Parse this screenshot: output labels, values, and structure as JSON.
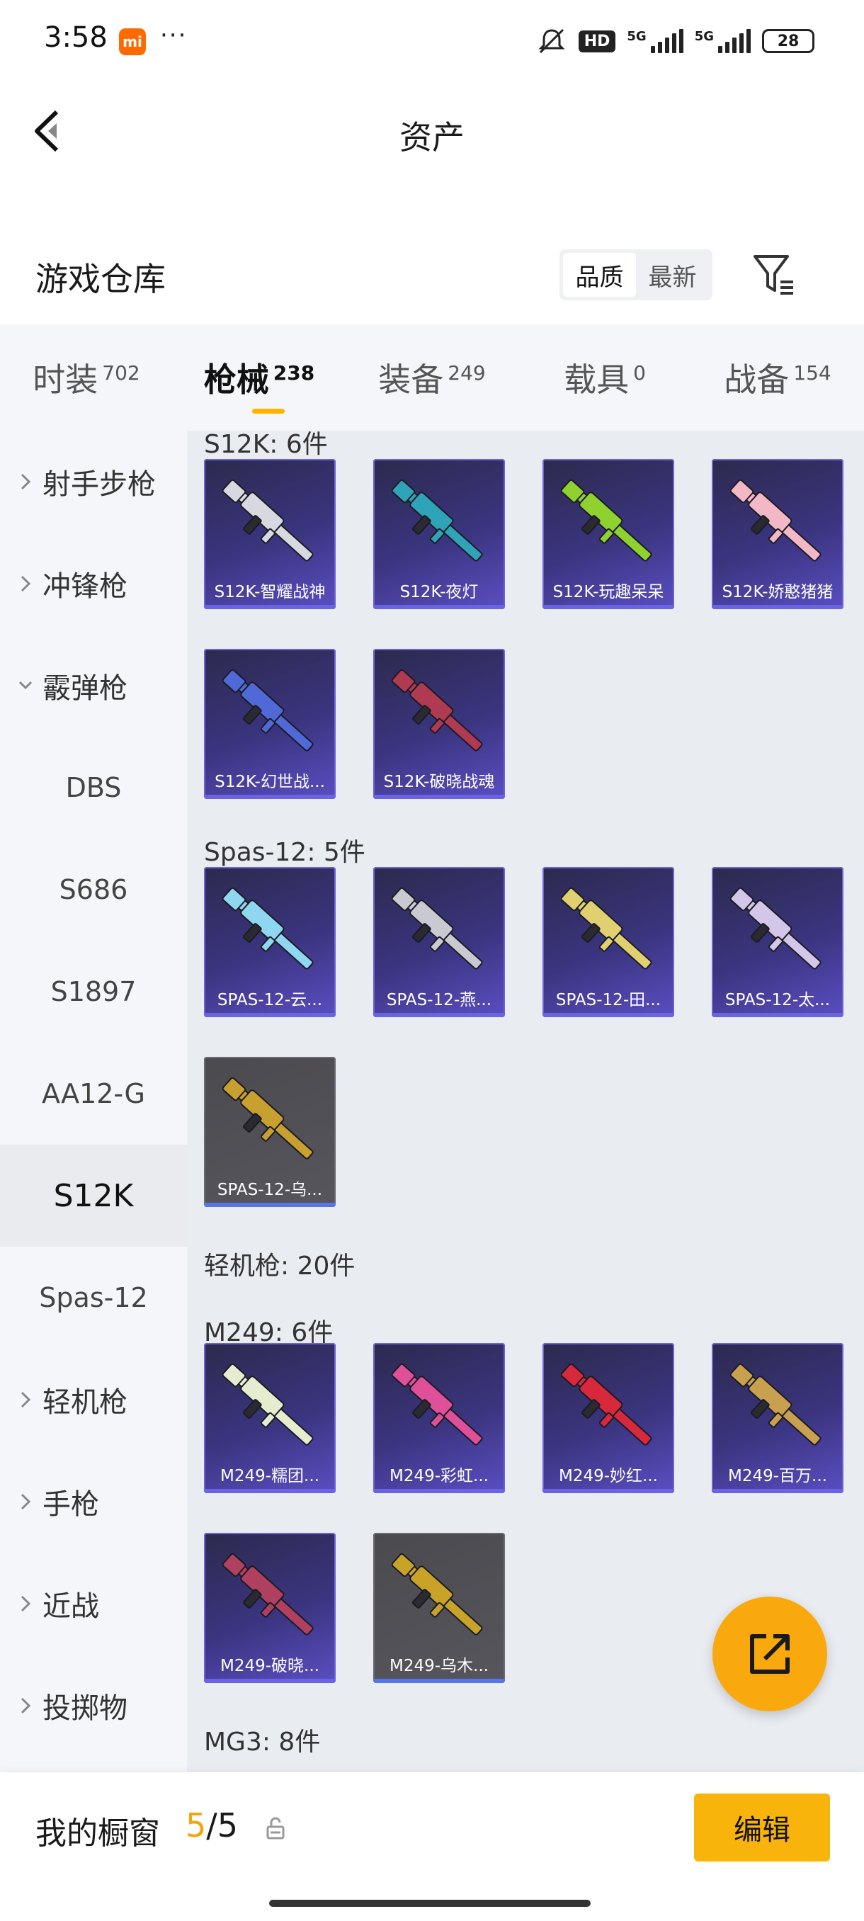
{
  "status_bar": {
    "time": "3:58",
    "mi": "mi",
    "dots": "···",
    "hd": "HD",
    "net1": "5G",
    "net2": "5G",
    "battery": "28"
  },
  "header": {
    "title": "资产"
  },
  "section": {
    "title": "游戏仓库",
    "sort_options": [
      "品质",
      "最新"
    ],
    "sort_active": "品质"
  },
  "tabs": [
    {
      "label": "时装",
      "count": "702"
    },
    {
      "label": "枪械",
      "count": "238",
      "active": true
    },
    {
      "label": "装备",
      "count": "249"
    },
    {
      "label": "载具",
      "count": "0"
    },
    {
      "label": "战备",
      "count": "154"
    }
  ],
  "sidebar": {
    "items": [
      {
        "label": "射手步枪",
        "type": "group",
        "expanded": false
      },
      {
        "label": "冲锋枪",
        "type": "group",
        "expanded": false
      },
      {
        "label": "霰弹枪",
        "type": "group",
        "expanded": true
      },
      {
        "label": "DBS",
        "type": "sub"
      },
      {
        "label": "S686",
        "type": "sub"
      },
      {
        "label": "S1897",
        "type": "sub"
      },
      {
        "label": "AA12-G",
        "type": "sub"
      },
      {
        "label": "S12K",
        "type": "sub",
        "active": true
      },
      {
        "label": "Spas-12",
        "type": "sub"
      },
      {
        "label": "轻机枪",
        "type": "group",
        "expanded": false
      },
      {
        "label": "手枪",
        "type": "group",
        "expanded": false
      },
      {
        "label": "近战",
        "type": "group",
        "expanded": false
      },
      {
        "label": "投掷物",
        "type": "group",
        "expanded": false
      }
    ]
  },
  "content": {
    "groups": [
      {
        "title": "S12K: 6件",
        "cards": [
          {
            "label": "S12K-智耀战神",
            "color": "#d8d8e0",
            "quality": "purple"
          },
          {
            "label": "S12K-夜灯",
            "color": "#2fa3b8",
            "quality": "purple"
          },
          {
            "label": "S12K-玩趣呆呆",
            "color": "#8fd12e",
            "quality": "purple"
          },
          {
            "label": "S12K-娇憨猪猪",
            "color": "#f2b8c6",
            "quality": "purple"
          },
          {
            "label": "S12K-幻世战...",
            "color": "#4f6ad8",
            "quality": "purple"
          },
          {
            "label": "S12K-破晓战魂",
            "color": "#b03a52",
            "quality": "purple"
          }
        ]
      },
      {
        "title": "Spas-12: 5件",
        "cards": [
          {
            "label": "SPAS-12-云...",
            "color": "#8fd6f0",
            "quality": "purple"
          },
          {
            "label": "SPAS-12-燕...",
            "color": "#c9c9d2",
            "quality": "purple"
          },
          {
            "label": "SPAS-12-田...",
            "color": "#e0d070",
            "quality": "purple"
          },
          {
            "label": "SPAS-12-太...",
            "color": "#d4c6e8",
            "quality": "purple"
          },
          {
            "label": "SPAS-12-乌...",
            "color": "#c8a030",
            "quality": "gray"
          }
        ]
      },
      {
        "title": "轻机枪: 20件"
      },
      {
        "title": "M249: 6件",
        "cards": [
          {
            "label": "M249-糯团...",
            "color": "#e6ecd0",
            "quality": "purple"
          },
          {
            "label": "M249-彩虹...",
            "color": "#e0509a",
            "quality": "purple"
          },
          {
            "label": "M249-妙红...",
            "color": "#d8283c",
            "quality": "purple"
          },
          {
            "label": "M249-百万...",
            "color": "#c8a050",
            "quality": "purple"
          },
          {
            "label": "M249-破晓...",
            "color": "#b04060",
            "quality": "purple"
          },
          {
            "label": "M249-乌木...",
            "color": "#c9a228",
            "quality": "gray"
          }
        ]
      },
      {
        "title": "MG3: 8件"
      }
    ]
  },
  "bottom": {
    "window_label": "我的橱窗",
    "window_current": "5",
    "window_sep": "/",
    "window_total": "5",
    "edit_label": "编辑"
  }
}
